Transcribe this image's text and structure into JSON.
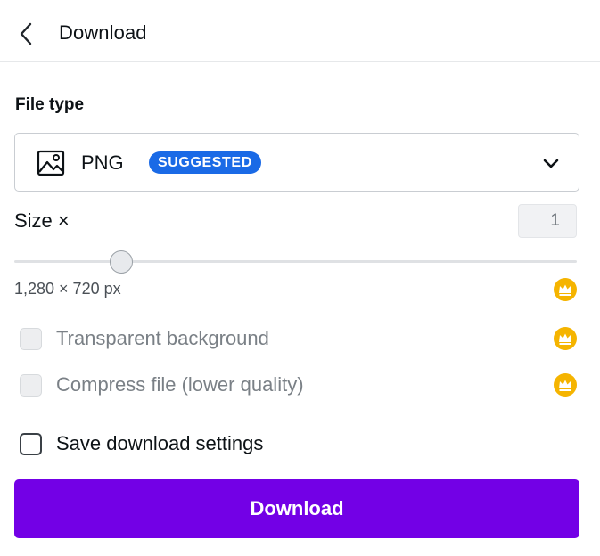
{
  "header": {
    "back_icon": "chevron-left-icon",
    "title": "Download"
  },
  "file_type": {
    "label": "File type",
    "selected": "PNG",
    "badge": "SUGGESTED",
    "icon": "image-icon",
    "dropdown_icon": "chevron-down-icon"
  },
  "size": {
    "label": "Size ×",
    "multiplier": "1",
    "slider_fraction": 0.19,
    "dimensions": "1,280 × 720 px",
    "premium_icon": "crown-icon"
  },
  "options": [
    {
      "label": "Transparent background",
      "checked": false,
      "disabled": true,
      "premium": true
    },
    {
      "label": "Compress file (lower quality)",
      "checked": false,
      "disabled": true,
      "premium": true
    },
    {
      "label": "Save download settings",
      "checked": false,
      "disabled": false,
      "premium": false
    }
  ],
  "download_button": {
    "label": "Download"
  },
  "colors": {
    "accent": "#7300e6",
    "badge": "#1a6ae6",
    "crown": "#f5b400"
  }
}
